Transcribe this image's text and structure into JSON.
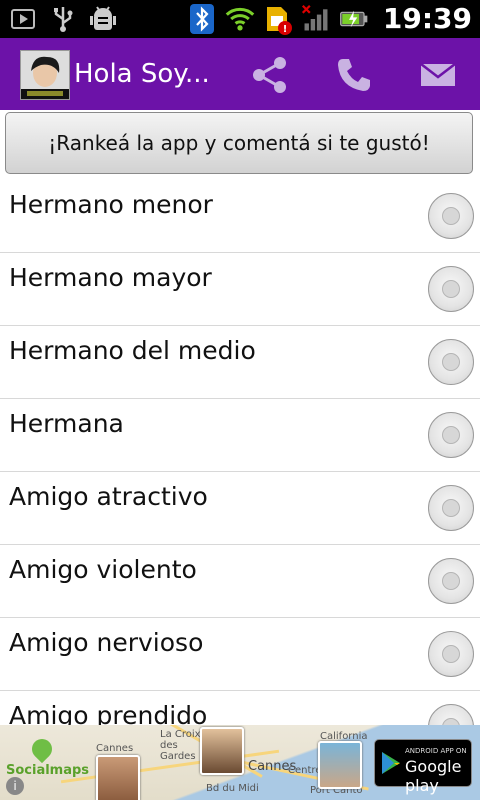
{
  "status_bar": {
    "time": "19:39",
    "icons": [
      "play-store-icon",
      "usb-icon",
      "android-debug-icon",
      "bluetooth-icon",
      "wifi-icon",
      "sim-alert-icon",
      "signal-icon",
      "battery-charging-icon"
    ]
  },
  "action_bar": {
    "title": "Hola Soy...",
    "background": "#6c12a8",
    "actions": [
      "share-icon",
      "phone-icon",
      "email-icon"
    ]
  },
  "rate_button": {
    "label": "¡Rankeá la app y comentá si te gustó!"
  },
  "list": {
    "items": [
      {
        "label": "Hermano menor",
        "selected": false
      },
      {
        "label": "Hermano mayor",
        "selected": false
      },
      {
        "label": "Hermano del medio",
        "selected": false
      },
      {
        "label": "Hermana",
        "selected": false
      },
      {
        "label": "Amigo atractivo",
        "selected": false
      },
      {
        "label": "Amigo violento",
        "selected": false
      },
      {
        "label": "Amigo nervioso",
        "selected": false
      },
      {
        "label": "Amigo prendido",
        "selected": false
      }
    ]
  },
  "ad_banner": {
    "brand": "Socialmaps",
    "map_labels": [
      "Cannes",
      "La Croix des Gardes",
      "California",
      "Cannes",
      "Centre",
      "Bd du Midi",
      "Port Canto"
    ],
    "store_badge_top": "ANDROID APP ON",
    "store_badge_main": "Google play"
  }
}
